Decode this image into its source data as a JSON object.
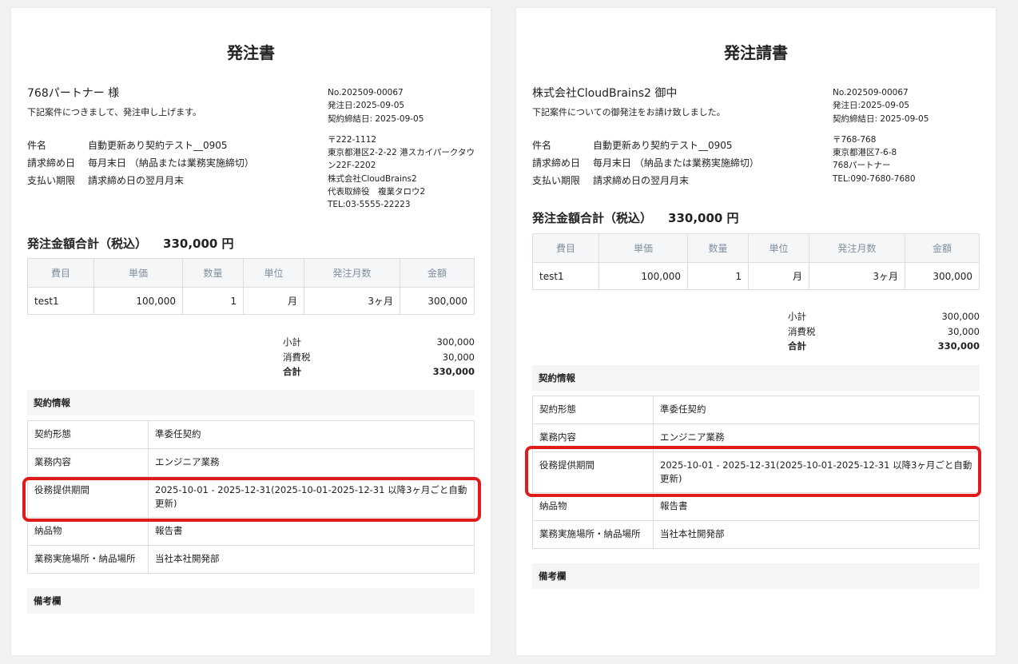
{
  "left": {
    "title": "発注書",
    "addressee": "768パートナー 様",
    "greeting": "下記案件につきまして、発注申し上げます。",
    "info": {
      "no": "No.202509-00067",
      "order_date": "発注日:2025-09-05",
      "contract_date": "契約締結日: 2025-09-05",
      "postal": "〒222-1112",
      "address": "東京都港区2-2-22 港スカイパークタウン22F-2202",
      "company": "株式会社CloudBrains2",
      "representative": "代表取締役　複業タロウ2",
      "tel": "TEL:03-5555-22223"
    },
    "kv": [
      {
        "key": "件名",
        "value": "自動更新あり契約テスト__0905"
      },
      {
        "key": "請求締め日",
        "value": "毎月末日 （納品または業務実施締切）"
      },
      {
        "key": "支払い期限",
        "value": "請求締め日の翌月月末"
      }
    ],
    "total_label": "発注金額合計（税込）",
    "total_amount": "330,000 円",
    "table_headers": [
      "費目",
      "単価",
      "数量",
      "単位",
      "発注月数",
      "金額"
    ],
    "table_row": [
      "test1",
      "100,000",
      "1",
      "月",
      "3ヶ月",
      "300,000"
    ],
    "sums": [
      {
        "label": "小計",
        "value": "300,000"
      },
      {
        "label": "消費税",
        "value": "30,000"
      },
      {
        "label": "合計",
        "value": "330,000"
      }
    ],
    "contract_section": "契約情報",
    "contract": [
      {
        "key": "契約形態",
        "value": "準委任契約"
      },
      {
        "key": "業務内容",
        "value": "エンジニア業務"
      },
      {
        "key": "役務提供期間",
        "value": "2025-10-01 - 2025-12-31(2025-10-01-2025-12-31 以降3ヶ月ごと自動更新)"
      },
      {
        "key": "納品物",
        "value": "報告書"
      },
      {
        "key": "業務実施場所・納品場所",
        "value": "当社本社開発部"
      }
    ],
    "remarks_section": "備考欄"
  },
  "right": {
    "title": "発注請書",
    "addressee": "株式会社CloudBrains2 御中",
    "greeting": "下記案件についての御発注をお請け致しました。",
    "info": {
      "no": "No.202509-00067",
      "order_date": "発注日:2025-09-05",
      "contract_date": "契約締結日: 2025-09-05",
      "postal": "〒768-768",
      "address": "東京都港区7-6-8",
      "company": "768パートナー",
      "tel": "TEL:090-7680-7680"
    },
    "kv": [
      {
        "key": "件名",
        "value": "自動更新あり契約テスト__0905"
      },
      {
        "key": "請求締め日",
        "value": "毎月末日 （納品または業務実施締切）"
      },
      {
        "key": "支払い期限",
        "value": "請求締め日の翌月月末"
      }
    ],
    "total_label": "発注金額合計（税込）",
    "total_amount": "330,000 円",
    "table_headers": [
      "費目",
      "単価",
      "数量",
      "単位",
      "発注月数",
      "金額"
    ],
    "table_row": [
      "test1",
      "100,000",
      "1",
      "月",
      "3ヶ月",
      "300,000"
    ],
    "sums": [
      {
        "label": "小計",
        "value": "300,000"
      },
      {
        "label": "消費税",
        "value": "30,000"
      },
      {
        "label": "合計",
        "value": "330,000"
      }
    ],
    "contract_section": "契約情報",
    "contract": [
      {
        "key": "契約形態",
        "value": "準委任契約"
      },
      {
        "key": "業務内容",
        "value": "エンジニア業務"
      },
      {
        "key": "役務提供期間",
        "value": "2025-10-01 - 2025-12-31(2025-10-01-2025-12-31 以降3ヶ月ごと自動更新)"
      },
      {
        "key": "納品物",
        "value": "報告書"
      },
      {
        "key": "業務実施場所・納品場所",
        "value": "当社本社開発部"
      }
    ],
    "remarks_section": "備考欄"
  },
  "colors": {
    "highlight": "#e01b1b",
    "header_bg": "#f5f6f7",
    "header_text": "#8090a0"
  }
}
